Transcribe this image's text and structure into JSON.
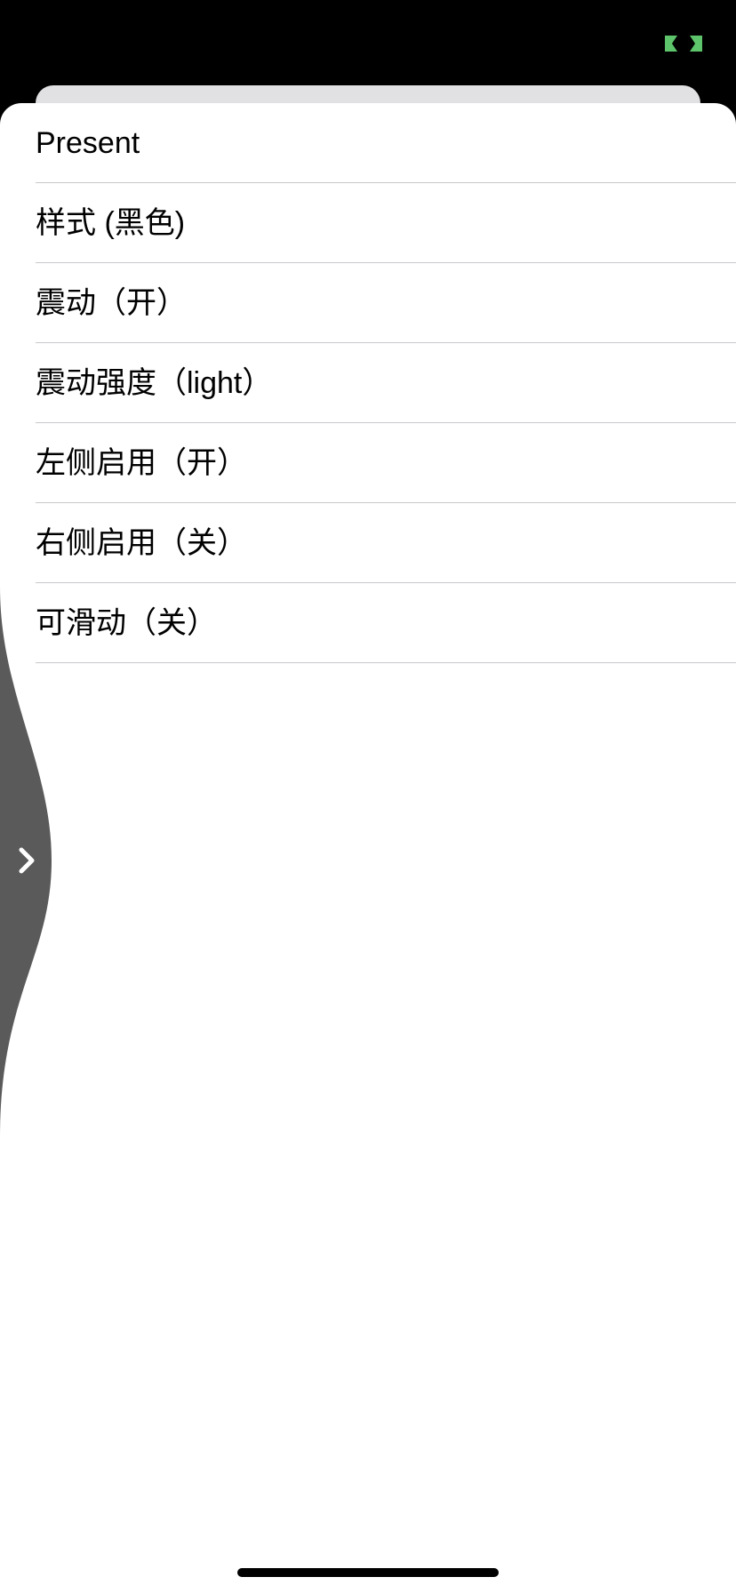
{
  "status_bar": {
    "indicator_icon": "green-bracket-indicator-icon",
    "indicator_color": "#5ec46b"
  },
  "menu": {
    "items": [
      {
        "label": "Present"
      },
      {
        "label": "样式 (黑色)"
      },
      {
        "label": "震动（开）"
      },
      {
        "label": "震动强度（light）"
      },
      {
        "label": "左侧启用（开）"
      },
      {
        "label": "右侧启用（关）"
      },
      {
        "label": "可滑动（关）"
      }
    ]
  },
  "edge_swipe": {
    "icon": "chevron-right-icon",
    "color": "#5a5a5a"
  },
  "colors": {
    "background": "#000000",
    "sheet": "#ffffff",
    "back_card": "#e1e1e3",
    "divider": "#c8c7cc",
    "text": "#000000"
  }
}
